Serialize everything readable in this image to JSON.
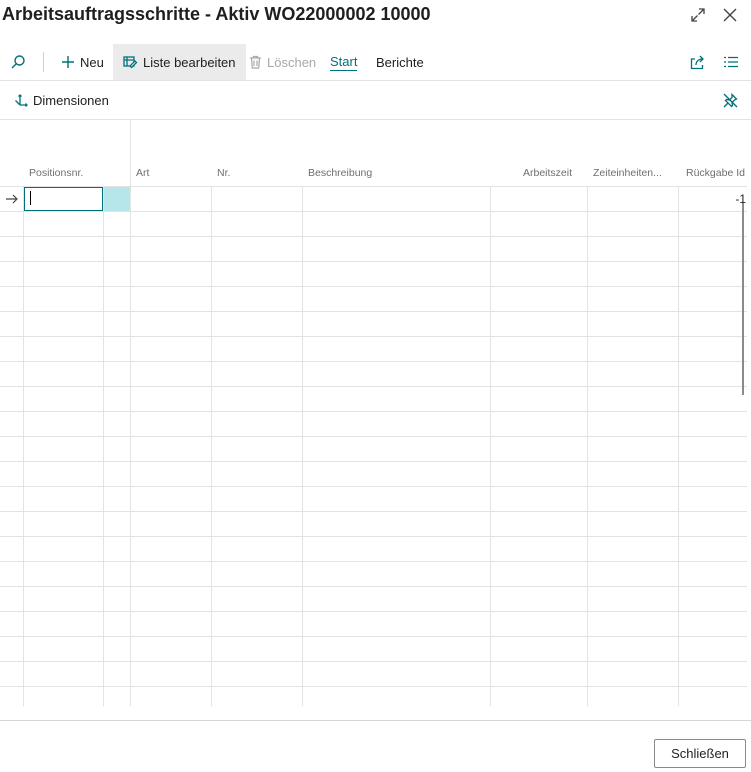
{
  "window": {
    "title": "Arbeitsauftragsschritte - Aktiv WO22000002 10000"
  },
  "toolbar": {
    "new_label": "Neu",
    "edit_list_label": "Liste bearbeiten",
    "delete_label": "Löschen",
    "start_label": "Start",
    "reports_label": "Berichte"
  },
  "actions": {
    "dimensions_label": "Dimensionen"
  },
  "grid": {
    "columns": [
      "Positionsnr.",
      "Art",
      "Nr.",
      "Beschreibung",
      "Arbeitszeit",
      "Zeiteinheiten...",
      "Rückgabe Id"
    ],
    "first_row_return_id": "-1"
  },
  "footer": {
    "close_label": "Schließen"
  },
  "colors": {
    "accent": "#00707a",
    "selected_cell": "#b7e6ea"
  }
}
